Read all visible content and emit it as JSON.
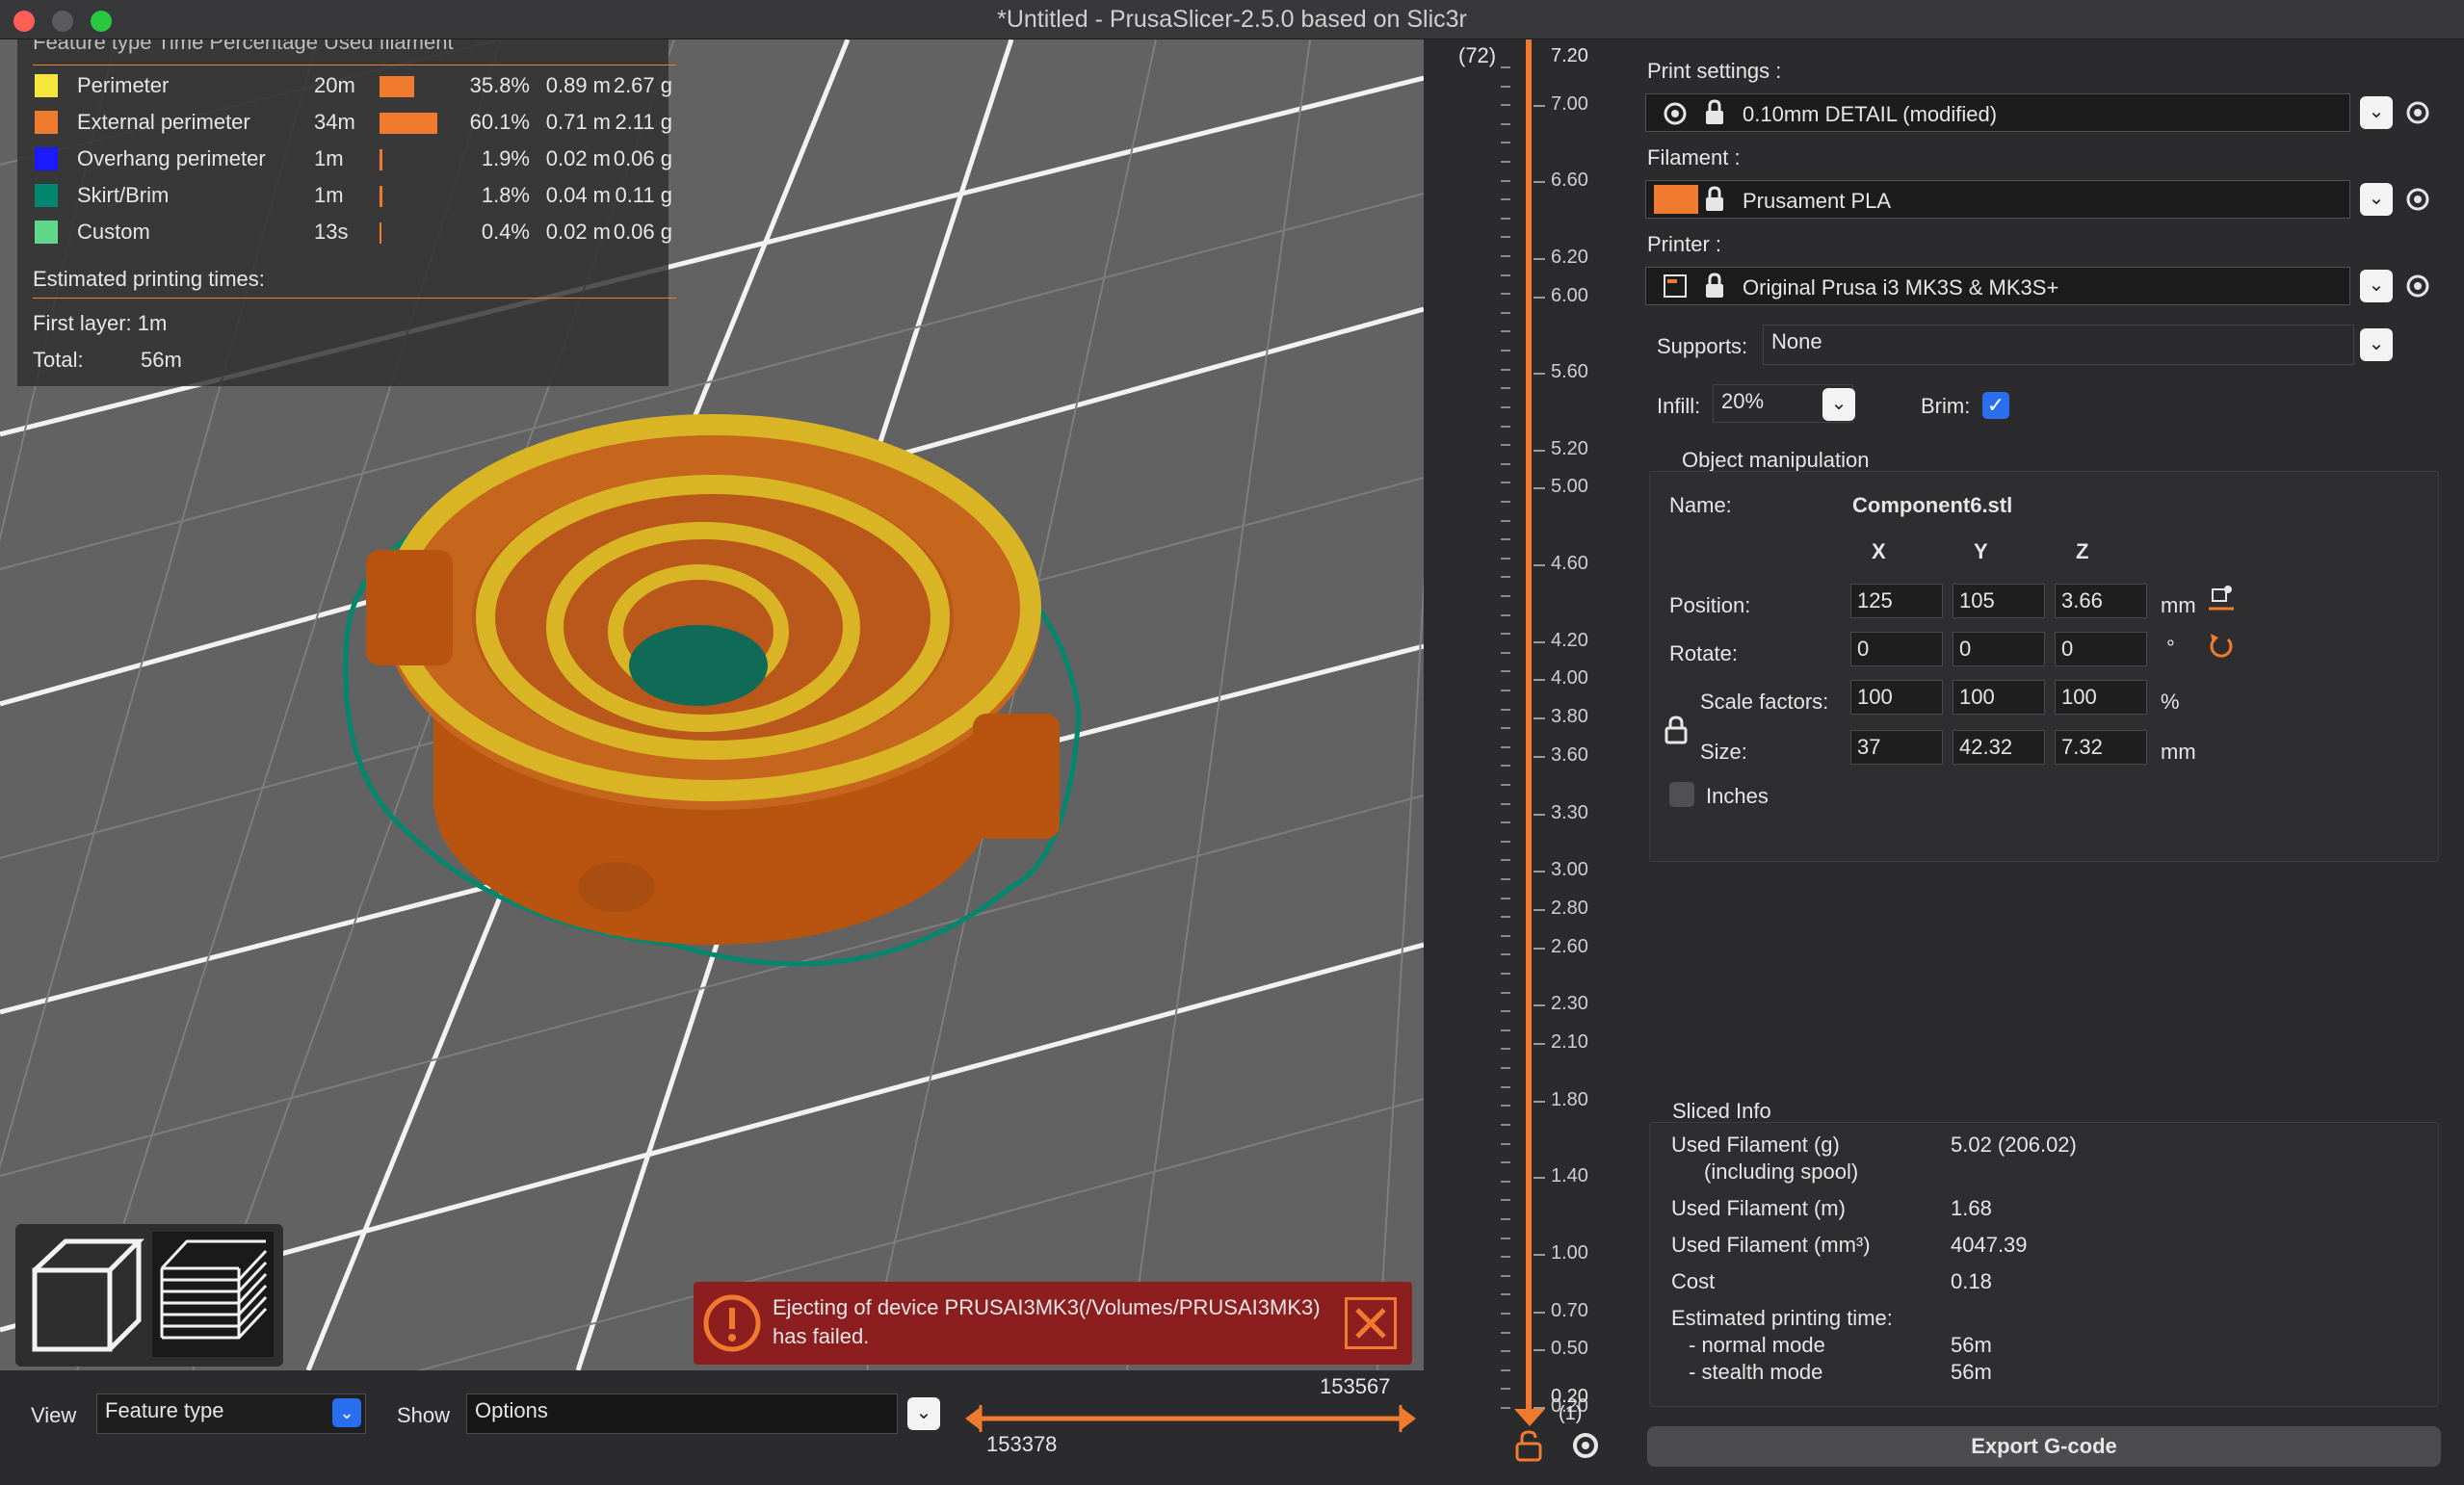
{
  "window": {
    "title": "*Untitled - PrusaSlicer-2.5.0 based on Slic3r"
  },
  "legend": {
    "header": "Feature type    Time   Percentage   Used filament",
    "rows": [
      {
        "name": "Perimeter",
        "time": "20m",
        "pct": "35.8%",
        "m": "0.89 m",
        "g": "2.67 g",
        "color": "#f5e63c",
        "fraction": 0.358
      },
      {
        "name": "External perimeter",
        "time": "34m",
        "pct": "60.1%",
        "m": "0.71 m",
        "g": "2.11 g",
        "color": "#f07a2e",
        "fraction": 0.601
      },
      {
        "name": "Overhang perimeter",
        "time": "1m",
        "pct": "1.9%",
        "m": "0.02 m",
        "g": "0.06 g",
        "color": "#1a1aff",
        "fraction": 0.019
      },
      {
        "name": "Skirt/Brim",
        "time": "1m",
        "pct": "1.8%",
        "m": "0.04 m",
        "g": "0.11 g",
        "color": "#00876e",
        "fraction": 0.018
      },
      {
        "name": "Custom",
        "time": "13s",
        "pct": "0.4%",
        "m": "0.02 m",
        "g": "0.06 g",
        "color": "#5ed68c",
        "fraction": 0.004
      }
    ],
    "est_title": "Estimated printing times:",
    "first_layer": "First layer: 1m",
    "total_label": "Total:",
    "total_value": "56m"
  },
  "toast": {
    "message_line1": "Ejecting of device PRUSAI3MK3(/Volumes/PRUSAI3MK3)",
    "message_line2": "has failed."
  },
  "bottom": {
    "view_label": "View",
    "view_value": "Feature type",
    "show_label": "Show",
    "show_value": "Options",
    "slider_max": "153567",
    "slider_min": "153378"
  },
  "ruler": {
    "top_count": "(72)",
    "bottom_count": "(1)",
    "top_value": "7.20",
    "ticks": [
      "7.00",
      "6.60",
      "6.20",
      "6.00",
      "5.60",
      "5.20",
      "5.00",
      "4.60",
      "4.20",
      "4.00",
      "3.80",
      "3.60",
      "3.30",
      "3.00",
      "2.80",
      "2.60",
      "2.30",
      "2.10",
      "1.80",
      "1.40",
      "1.00",
      "0.70",
      "0.50",
      "0.20"
    ],
    "bottom_value": "0.20"
  },
  "settings": {
    "print_label": "Print settings :",
    "print_value": "0.10mm DETAIL (modified)",
    "filament_label": "Filament :",
    "filament_value": "Prusament PLA",
    "filament_color": "#f07a2e",
    "printer_label": "Printer :",
    "printer_value": "Original Prusa i3 MK3S & MK3S+",
    "supports_label": "Supports:",
    "supports_value": "None",
    "infill_label": "Infill:",
    "infill_value": "20%",
    "brim_label": "Brim:",
    "brim_checked": true
  },
  "object": {
    "section": "Object manipulation",
    "name_label": "Name:",
    "name_value": "Component6.stl",
    "axes": [
      "X",
      "Y",
      "Z"
    ],
    "position_label": "Position:",
    "position": [
      "125",
      "105",
      "3.66"
    ],
    "position_unit": "mm",
    "rotate_label": "Rotate:",
    "rotate": [
      "0",
      "0",
      "0"
    ],
    "rotate_unit": "°",
    "scale_label": "Scale factors:",
    "scale": [
      "100",
      "100",
      "100"
    ],
    "scale_unit": "%",
    "size_label": "Size:",
    "size": [
      "37",
      "42.32",
      "7.32"
    ],
    "size_unit": "mm",
    "inches_label": "Inches"
  },
  "sliced": {
    "section": "Sliced Info",
    "filament_g_label": "Used Filament (g)",
    "filament_g_sub": "(including spool)",
    "filament_g_value": "5.02 (206.02)",
    "filament_m_label": "Used Filament (m)",
    "filament_m_value": "1.68",
    "filament_mm3_label": "Used Filament (mm³)",
    "filament_mm3_value": "4047.39",
    "cost_label": "Cost",
    "cost_value": "0.18",
    "est_label": "Estimated printing time:",
    "normal_label": "- normal mode",
    "normal_value": "56m",
    "stealth_label": "- stealth mode",
    "stealth_value": "56m"
  },
  "export_button": "Export G-code"
}
